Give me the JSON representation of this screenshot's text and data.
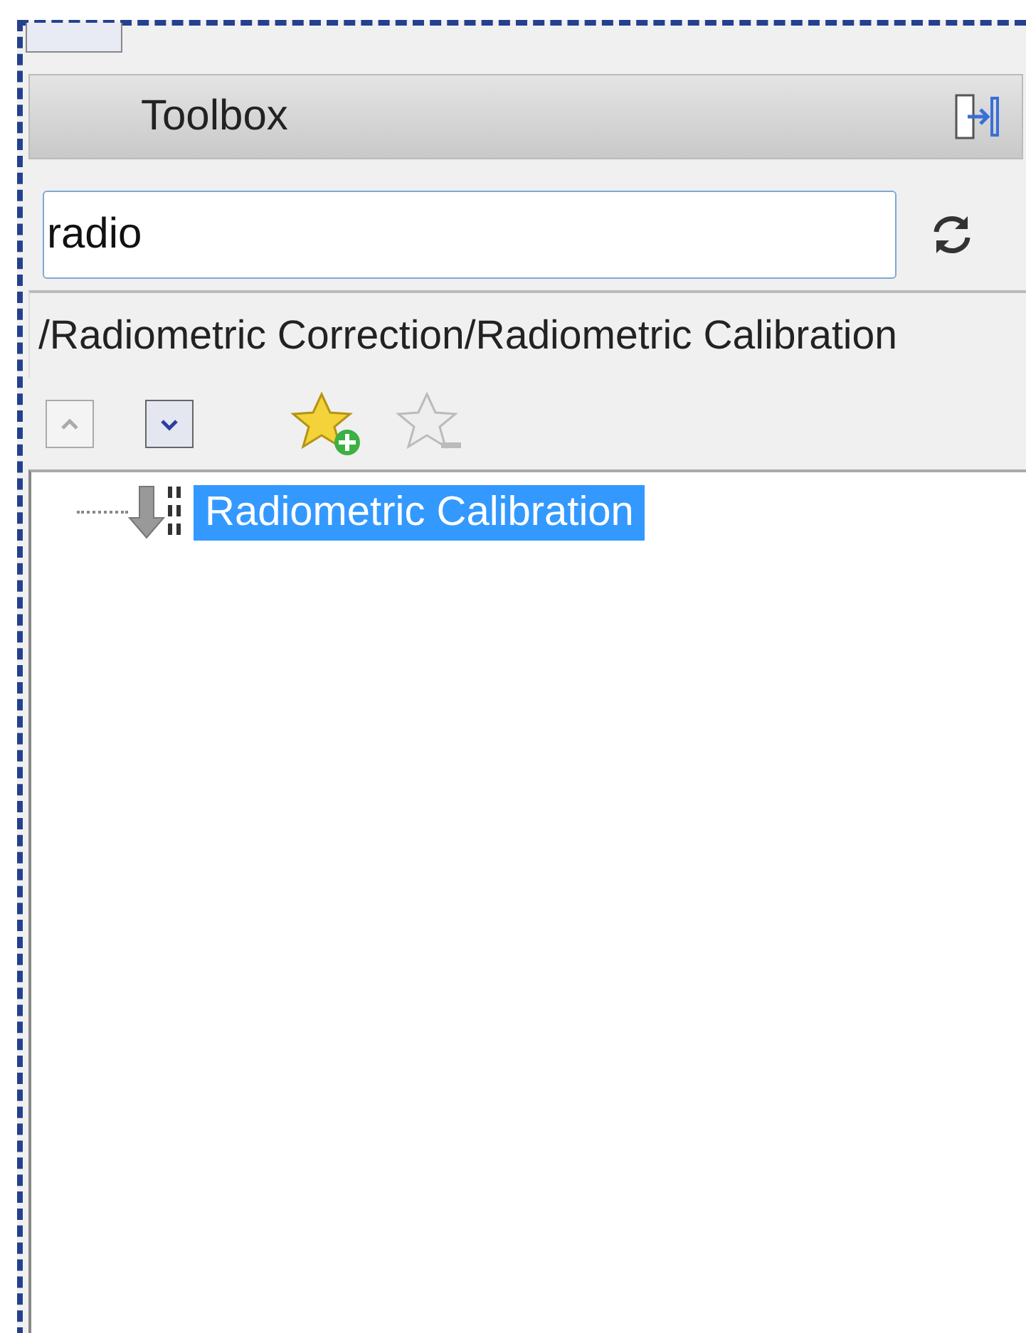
{
  "panel": {
    "title": "Toolbox"
  },
  "search": {
    "value": "radio"
  },
  "path": "/Radiometric Correction/Radiometric Calibration",
  "toolbar": [
    {
      "kind": "up",
      "disabled": true
    },
    {
      "kind": "down",
      "disabled": false
    },
    {
      "kind": "add-favorite",
      "disabled": false
    },
    {
      "kind": "remove-favorite",
      "disabled": true
    }
  ],
  "tree": [
    {
      "label": "Radiometric Calibration",
      "selected": true
    }
  ]
}
